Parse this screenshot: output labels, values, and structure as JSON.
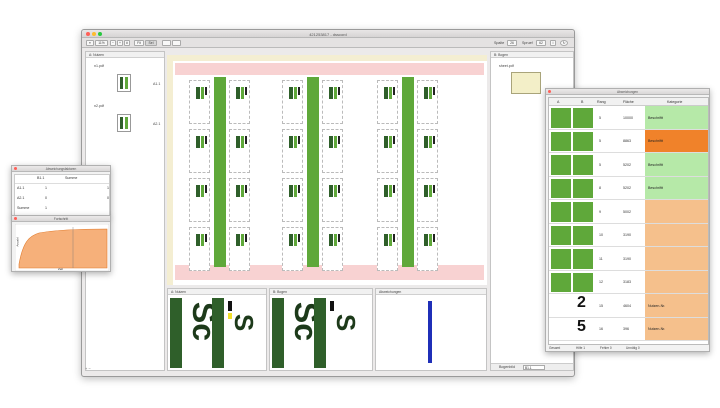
{
  "window": {
    "title": "421253817 - dsscord"
  },
  "toolbar": {
    "zoom": "11%",
    "fit_label": "Fit",
    "sel_label": "Sel",
    "spalte_label": "Spalte",
    "spalte_value": "26",
    "spruef_label": "Spruef",
    "spruef_value": "62"
  },
  "left_panel": {
    "title": "A: Nutzen",
    "files": [
      {
        "name": "n1.pdf",
        "id": "A1.1"
      },
      {
        "name": "n2.pdf",
        "id": "A2.1"
      }
    ]
  },
  "right_panel": {
    "title": "B: Bogen",
    "file": "sheet.pdf",
    "footer_label": "Bogenbild",
    "footer_value": "B1.1"
  },
  "bottom_panels": {
    "nutzen": "A: Nutzen",
    "bogen": "B: Bogen",
    "abweichungen": "Abweichungen"
  },
  "dialog_small": {
    "title": "Abweichungsfaktoren",
    "col1": "B1.1",
    "col2": "Summe",
    "rows": [
      {
        "label": "A1.1",
        "v1": "1",
        "v2": "1"
      },
      {
        "label": "A2.1",
        "v1": "0",
        "v2": "0"
      },
      {
        "label": "Summe",
        "v1": "1",
        "v2": ""
      }
    ]
  },
  "dialog_graph": {
    "title": "Fortschritt",
    "ylabel": "Anzahl",
    "xlabel": "Zeit"
  },
  "dialog_table": {
    "title": "Abweichungen",
    "headers": [
      "A",
      "B",
      "Rang",
      "Fläche",
      "Kategorie"
    ],
    "rows": [
      {
        "rang": "5",
        "flaeche": "10000",
        "kat": "Beschriftt",
        "color": "#b6e9a8"
      },
      {
        "rang": "5",
        "flaeche": "8863",
        "kat": "Beschriftt",
        "color": "#f0822a"
      },
      {
        "rang": "5",
        "flaeche": "5202",
        "kat": "Beschriftt",
        "color": "#b6e9a8"
      },
      {
        "rang": "8",
        "flaeche": "5202",
        "kat": "Beschriftt",
        "color": "#b6e9a8"
      },
      {
        "rang": "9",
        "flaeche": "5002",
        "kat": "",
        "color": "#f5c08c"
      },
      {
        "rang": "10",
        "flaeche": "3190",
        "kat": "",
        "color": "#f5c08c"
      },
      {
        "rang": "11",
        "flaeche": "3190",
        "kat": "",
        "color": "#f5c08c"
      },
      {
        "rang": "12",
        "flaeche": "3183",
        "kat": "",
        "color": "#f5c08c"
      },
      {
        "rang": "15",
        "flaeche": "4604",
        "kat": "Nutzen-Nr.",
        "color": "#f5c08c"
      },
      {
        "rang": "16",
        "flaeche": "396",
        "kat": "Nutzen-Nr.",
        "color": "#f5c08c"
      }
    ],
    "glyph_a": "2",
    "glyph_b": "5",
    "footer_label": "Gesamt",
    "footer_items": [
      "Hilfe 1",
      "Fehler 0",
      "Unnötig 0"
    ]
  }
}
